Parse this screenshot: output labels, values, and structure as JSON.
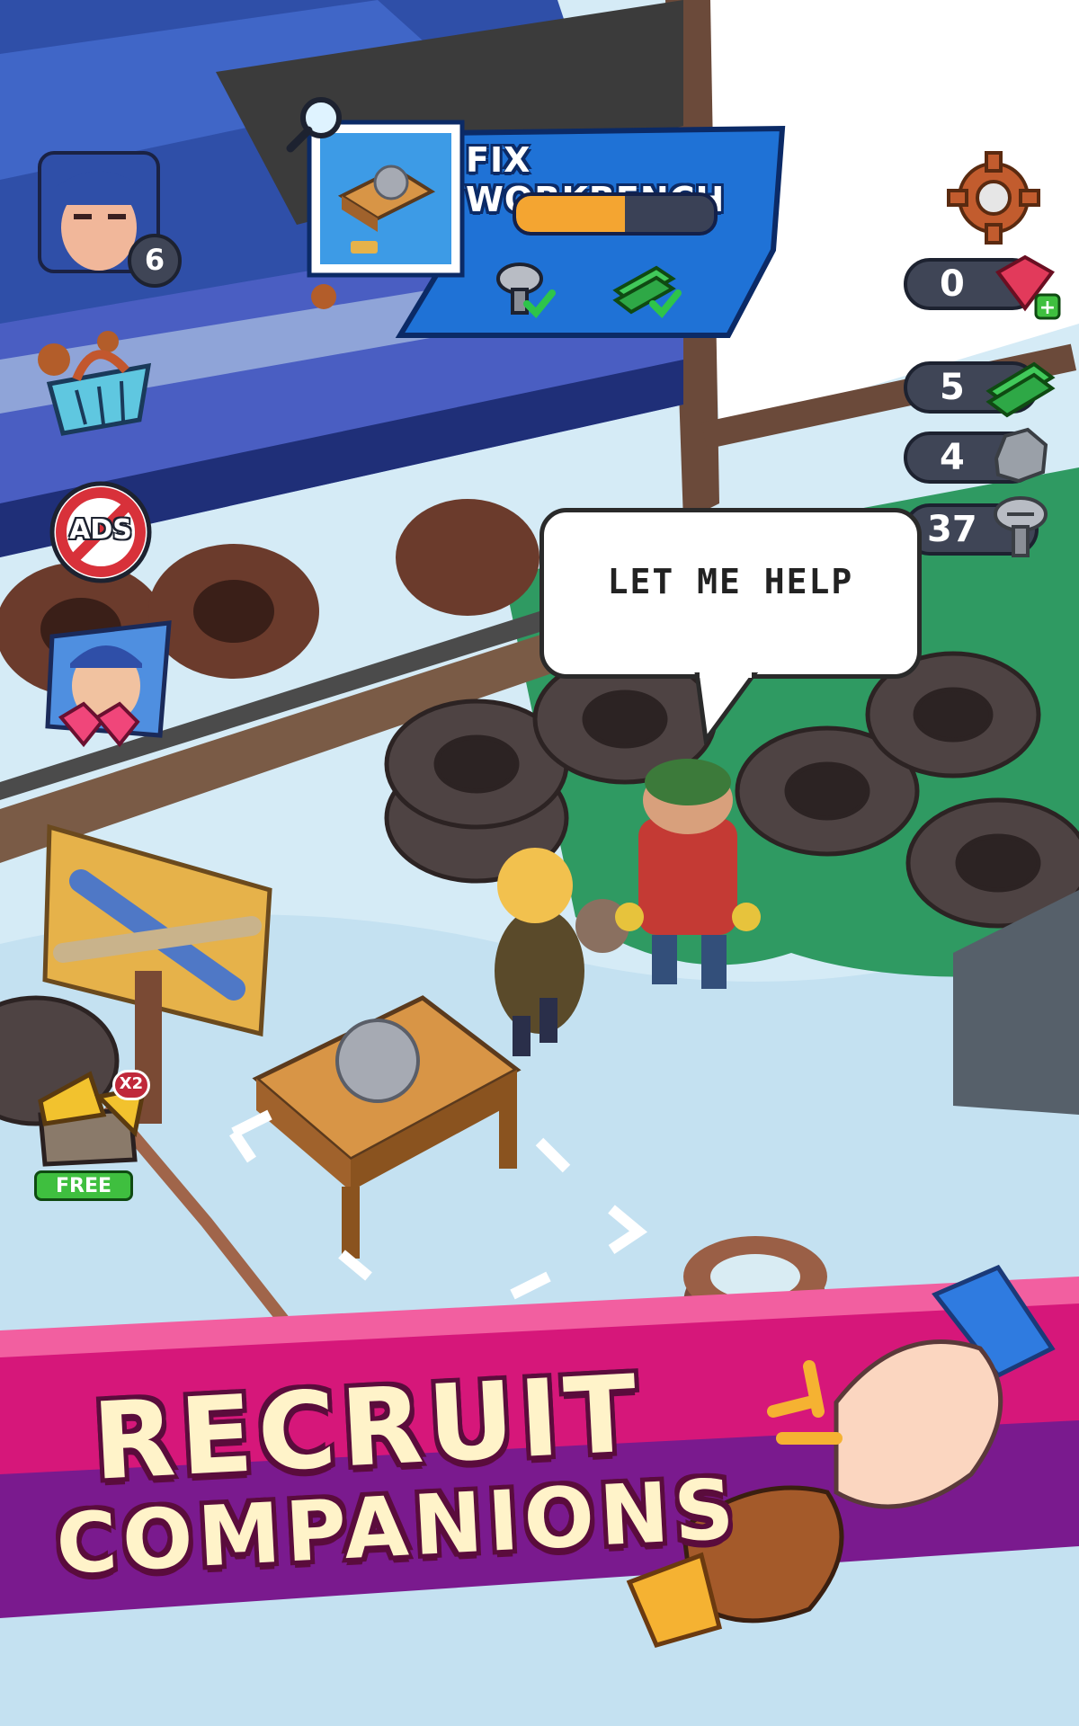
{
  "player": {
    "level": "6"
  },
  "quest": {
    "title": "FIX WORKBENCH",
    "progress": 0.55,
    "requirements": [
      {
        "icon": "screw-icon",
        "done": true
      },
      {
        "icon": "green-plank-icon",
        "done": true
      }
    ]
  },
  "resources": {
    "gems": "0",
    "planks": "5",
    "stones": "4",
    "screws": "37"
  },
  "side_buttons": {
    "free_label": "FREE",
    "multiplier": "X2",
    "ads_label": "ADS"
  },
  "speech_bubble": "LET ME HELP",
  "banner": {
    "line1": "RECRUIT",
    "line2": "COMPANIONS"
  },
  "colors": {
    "quest_panel": "#1f72d6",
    "progress_fill": "#f4a531",
    "banner_magenta": "#d6177a",
    "banner_purple": "#7a1a8e",
    "banner_text": "#fff3c9",
    "gem": "#e23a5b",
    "plank": "#41c95a"
  }
}
